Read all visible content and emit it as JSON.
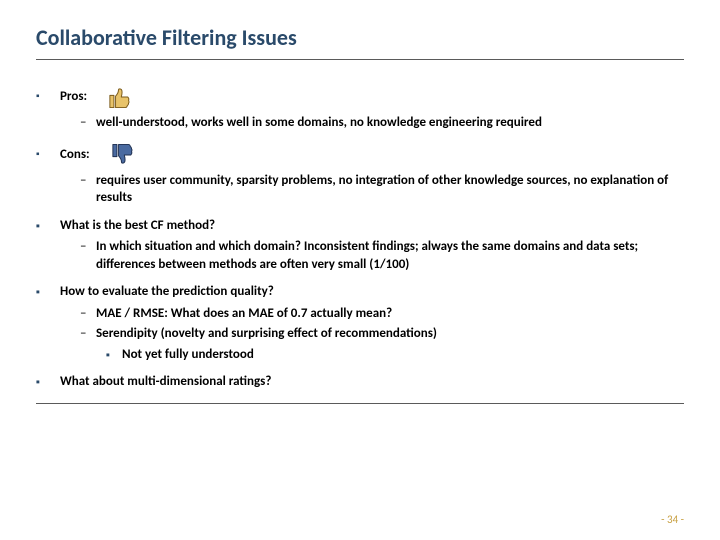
{
  "title": "Collaborative Filtering Issues",
  "pros": {
    "label": "Pros:",
    "items": [
      "well-understood, works well in some domains, no knowledge engineering required"
    ]
  },
  "cons": {
    "label": "Cons:",
    "items": [
      "requires user community, sparsity problems, no integration of other knowledge sources, no explanation of results"
    ]
  },
  "q1": {
    "label": "What is the best CF method?",
    "items": [
      "In which situation and which domain? Inconsistent findings; always the same domains and data sets; differences between methods are often very small (1/100)"
    ]
  },
  "q2": {
    "label": "How to evaluate the prediction quality?",
    "items": [
      "MAE / RMSE: What does an MAE of 0.7 actually mean?",
      "Serendipity (novelty and surprising effect of recommendations)"
    ],
    "subitems": [
      "Not yet fully understood"
    ]
  },
  "q3": {
    "label": "What about multi-dimensional ratings?"
  },
  "page": "- 34 -"
}
